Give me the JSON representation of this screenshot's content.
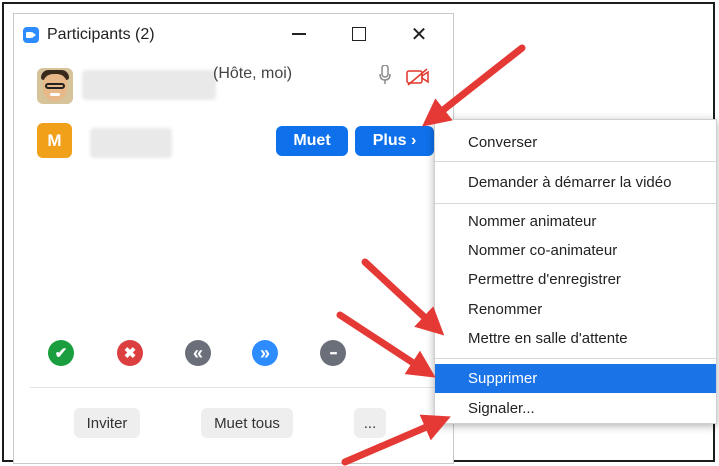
{
  "window": {
    "title": "Participants (2)",
    "minimize_icon": "minimize-icon",
    "maximize_icon": "maximize-icon",
    "close_icon": "close-icon",
    "close_glyph": "✕"
  },
  "participants": [
    {
      "avatar": "host-avatar",
      "label": "(Hôte, moi)",
      "mic_icon": "microphone-icon",
      "video_icon": "video-off-icon"
    },
    {
      "avatar_letter": "M",
      "mute_label": "Muet",
      "more_label": "Plus ›"
    }
  ],
  "reactions": [
    {
      "icon": "check-icon",
      "glyph": "✔",
      "color": "#1a9e3f"
    },
    {
      "icon": "x-icon",
      "glyph": "✖",
      "color": "#dc3f3f"
    },
    {
      "icon": "rewind-icon",
      "glyph": "«",
      "color": "#6b6f7a"
    },
    {
      "icon": "fast-forward-icon",
      "glyph": "»",
      "color": "#2d8cff"
    },
    {
      "icon": "more-icon",
      "glyph": "•••",
      "color": "#6b6f7a"
    }
  ],
  "footer": {
    "invite_label": "Inviter",
    "mute_all_label": "Muet tous",
    "more_label": "..."
  },
  "menu": {
    "items": [
      "Converser",
      "Demander à démarrer la vidéo",
      "Nommer animateur",
      "Nommer co-animateur",
      "Permettre d'enregistrer",
      "Renommer",
      "Mettre en salle d'attente",
      "Supprimer",
      "Signaler..."
    ],
    "active_index": 7
  },
  "colors": {
    "accent": "#0e71eb",
    "menu_highlight": "#1a74e8",
    "annotation_arrow": "#e53935"
  }
}
